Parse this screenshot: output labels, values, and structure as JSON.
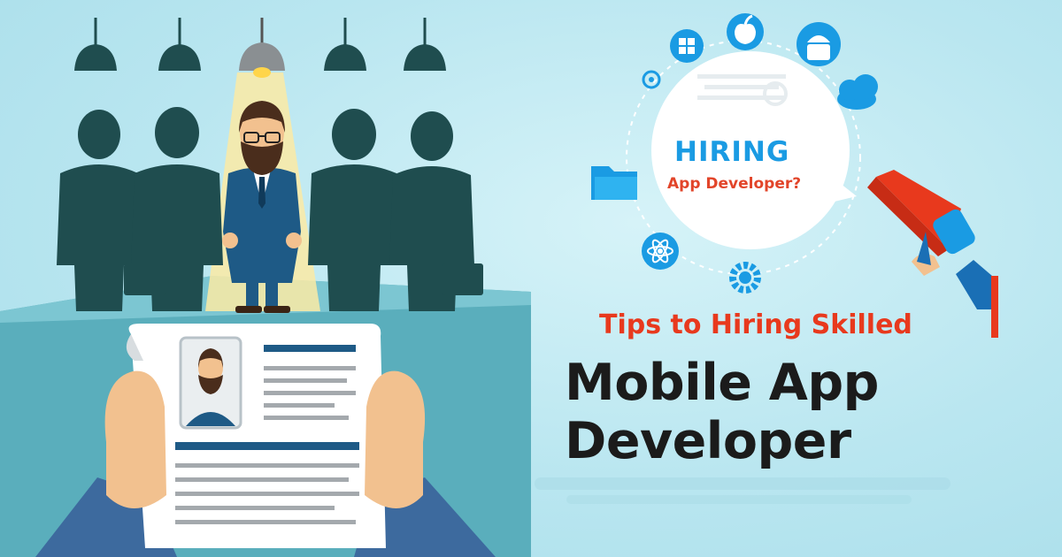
{
  "bubble": {
    "title": "HIRING",
    "subtitle": "App Developer?"
  },
  "headline": {
    "tips": "Tips to Hiring Skilled",
    "line1": "Mobile App",
    "line2": "Developer"
  },
  "colors": {
    "accent_blue": "#1a9be3",
    "accent_red": "#e8391d",
    "silhouette": "#1f4d4f",
    "suit": "#1e5a86",
    "background": "#bfe9f2"
  },
  "icons": [
    "windows-icon",
    "apple-icon",
    "android-icon",
    "cloud-icon",
    "folder-icon",
    "react-icon",
    "gear-icon",
    "megaphone-icon",
    "target-icon"
  ]
}
